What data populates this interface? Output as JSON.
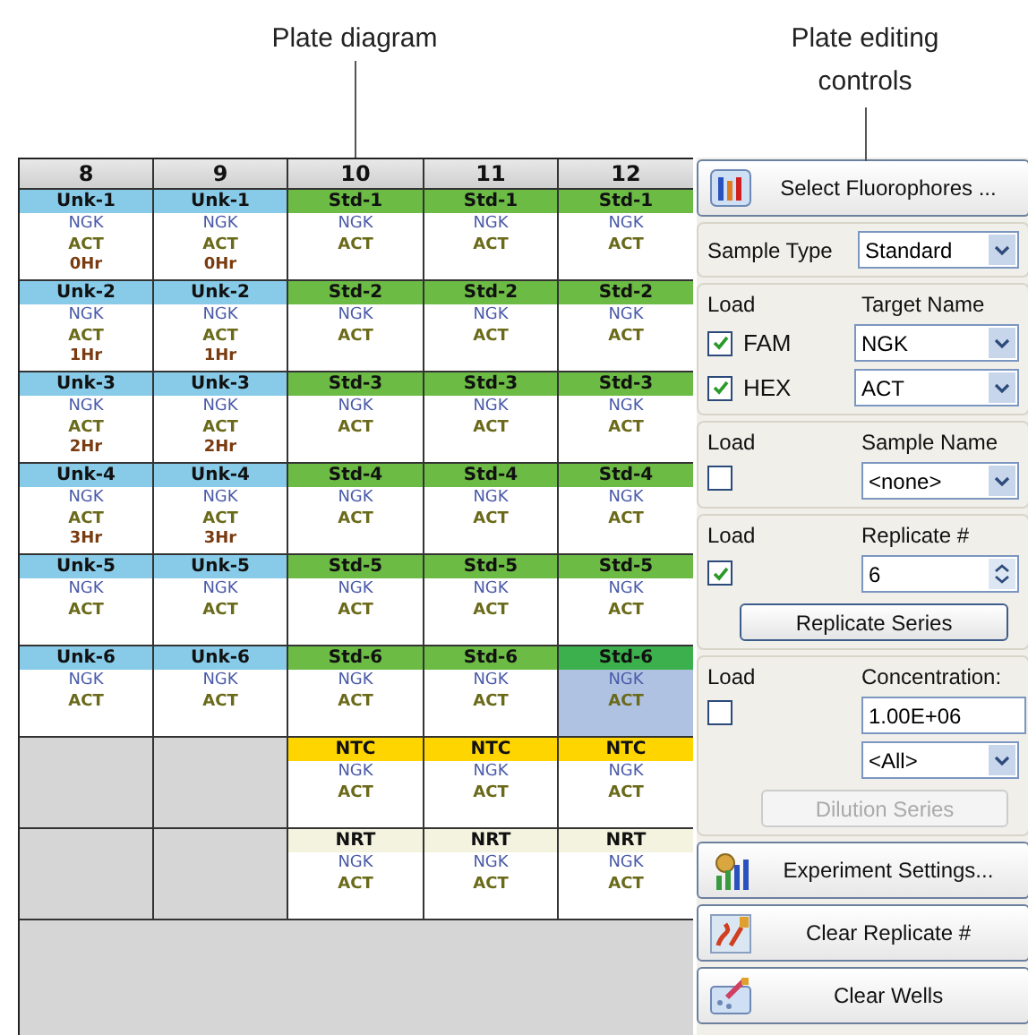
{
  "annotations": [
    {
      "text": "Plate diagram"
    },
    {
      "text": "Plate editing controls"
    }
  ],
  "plate": {
    "columns": [
      "8",
      "9",
      "10",
      "11",
      "12"
    ],
    "rows": [
      {
        "wells": [
          {
            "kind": "unk",
            "label": "Unk-1",
            "targets": [
              "NGK",
              "ACT"
            ],
            "note": "0Hr",
            "selected": false
          },
          {
            "kind": "unk",
            "label": "Unk-1",
            "targets": [
              "NGK",
              "ACT"
            ],
            "note": "0Hr",
            "selected": false
          },
          {
            "kind": "std",
            "label": "Std-1",
            "targets": [
              "NGK",
              "ACT"
            ],
            "selected": false
          },
          {
            "kind": "std",
            "label": "Std-1",
            "targets": [
              "NGK",
              "ACT"
            ],
            "selected": false
          },
          {
            "kind": "std",
            "label": "Std-1",
            "targets": [
              "NGK",
              "ACT"
            ],
            "selected": false
          }
        ]
      },
      {
        "wells": [
          {
            "kind": "unk",
            "label": "Unk-2",
            "targets": [
              "NGK",
              "ACT"
            ],
            "note": "1Hr",
            "selected": false
          },
          {
            "kind": "unk",
            "label": "Unk-2",
            "targets": [
              "NGK",
              "ACT"
            ],
            "note": "1Hr",
            "selected": false
          },
          {
            "kind": "std",
            "label": "Std-2",
            "targets": [
              "NGK",
              "ACT"
            ],
            "selected": false
          },
          {
            "kind": "std",
            "label": "Std-2",
            "targets": [
              "NGK",
              "ACT"
            ],
            "selected": false
          },
          {
            "kind": "std",
            "label": "Std-2",
            "targets": [
              "NGK",
              "ACT"
            ],
            "selected": false
          }
        ]
      },
      {
        "wells": [
          {
            "kind": "unk",
            "label": "Unk-3",
            "targets": [
              "NGK",
              "ACT"
            ],
            "note": "2Hr",
            "selected": false
          },
          {
            "kind": "unk",
            "label": "Unk-3",
            "targets": [
              "NGK",
              "ACT"
            ],
            "note": "2Hr",
            "selected": false
          },
          {
            "kind": "std",
            "label": "Std-3",
            "targets": [
              "NGK",
              "ACT"
            ],
            "selected": false
          },
          {
            "kind": "std",
            "label": "Std-3",
            "targets": [
              "NGK",
              "ACT"
            ],
            "selected": false
          },
          {
            "kind": "std",
            "label": "Std-3",
            "targets": [
              "NGK",
              "ACT"
            ],
            "selected": false
          }
        ]
      },
      {
        "wells": [
          {
            "kind": "unk",
            "label": "Unk-4",
            "targets": [
              "NGK",
              "ACT"
            ],
            "note": "3Hr",
            "selected": false
          },
          {
            "kind": "unk",
            "label": "Unk-4",
            "targets": [
              "NGK",
              "ACT"
            ],
            "note": "3Hr",
            "selected": false
          },
          {
            "kind": "std",
            "label": "Std-4",
            "targets": [
              "NGK",
              "ACT"
            ],
            "selected": false
          },
          {
            "kind": "std",
            "label": "Std-4",
            "targets": [
              "NGK",
              "ACT"
            ],
            "selected": false
          },
          {
            "kind": "std",
            "label": "Std-4",
            "targets": [
              "NGK",
              "ACT"
            ],
            "selected": false
          }
        ]
      },
      {
        "wells": [
          {
            "kind": "unk",
            "label": "Unk-5",
            "targets": [
              "NGK",
              "ACT"
            ],
            "selected": false
          },
          {
            "kind": "unk",
            "label": "Unk-5",
            "targets": [
              "NGK",
              "ACT"
            ],
            "selected": false
          },
          {
            "kind": "std",
            "label": "Std-5",
            "targets": [
              "NGK",
              "ACT"
            ],
            "selected": false
          },
          {
            "kind": "std",
            "label": "Std-5",
            "targets": [
              "NGK",
              "ACT"
            ],
            "selected": false
          },
          {
            "kind": "std",
            "label": "Std-5",
            "targets": [
              "NGK",
              "ACT"
            ],
            "selected": false
          }
        ]
      },
      {
        "wells": [
          {
            "kind": "unk",
            "label": "Unk-6",
            "targets": [
              "NGK",
              "ACT"
            ],
            "selected": false
          },
          {
            "kind": "unk",
            "label": "Unk-6",
            "targets": [
              "NGK",
              "ACT"
            ],
            "selected": false
          },
          {
            "kind": "std",
            "label": "Std-6",
            "targets": [
              "NGK",
              "ACT"
            ],
            "selected": false
          },
          {
            "kind": "std",
            "label": "Std-6",
            "targets": [
              "NGK",
              "ACT"
            ],
            "selected": false
          },
          {
            "kind": "std",
            "label": "Std-6",
            "targets": [
              "NGK",
              "ACT"
            ],
            "selected": true
          }
        ]
      },
      {
        "wells": [
          {
            "kind": "empty",
            "selected": false
          },
          {
            "kind": "empty",
            "selected": false
          },
          {
            "kind": "ntc",
            "label": "NTC",
            "targets": [
              "NGK",
              "ACT"
            ],
            "selected": false
          },
          {
            "kind": "ntc",
            "label": "NTC",
            "targets": [
              "NGK",
              "ACT"
            ],
            "selected": false
          },
          {
            "kind": "ntc",
            "label": "NTC",
            "targets": [
              "NGK",
              "ACT"
            ],
            "selected": false
          }
        ]
      },
      {
        "wells": [
          {
            "kind": "empty",
            "selected": false
          },
          {
            "kind": "empty",
            "selected": false
          },
          {
            "kind": "nrt",
            "label": "NRT",
            "targets": [
              "NGK",
              "ACT"
            ],
            "selected": false
          },
          {
            "kind": "nrt",
            "label": "NRT",
            "targets": [
              "NGK",
              "ACT"
            ],
            "selected": false
          },
          {
            "kind": "nrt",
            "label": "NRT",
            "targets": [
              "NGK",
              "ACT"
            ],
            "selected": false
          }
        ]
      }
    ]
  },
  "controls": {
    "select_fluorophores": "Select Fluorophores ...",
    "sample_type": {
      "label": "Sample Type",
      "value": "Standard"
    },
    "targets": {
      "load_label": "Load",
      "name_label": "Target Name",
      "items": [
        {
          "dye": "FAM",
          "checked": true,
          "value": "NGK"
        },
        {
          "dye": "HEX",
          "checked": true,
          "value": "ACT"
        }
      ]
    },
    "sample_name": {
      "load_label": "Load",
      "checked": false,
      "label": "Sample Name",
      "value": "<none>"
    },
    "replicate": {
      "load_label": "Load",
      "checked": true,
      "label": "Replicate #",
      "value": "6",
      "button": "Replicate Series"
    },
    "concentration": {
      "load_label": "Load",
      "checked": false,
      "label": "Concentration:",
      "value": "1.00E+06",
      "unit": "<All>",
      "button": {
        "text": "Dilution Series",
        "disabled": true
      }
    },
    "buttons": [
      {
        "kind": "settings",
        "text": "Experiment Settings..."
      },
      {
        "kind": "clear_replicate",
        "text": "Clear Replicate #"
      },
      {
        "kind": "clear_wells",
        "text": "Clear Wells"
      }
    ]
  }
}
